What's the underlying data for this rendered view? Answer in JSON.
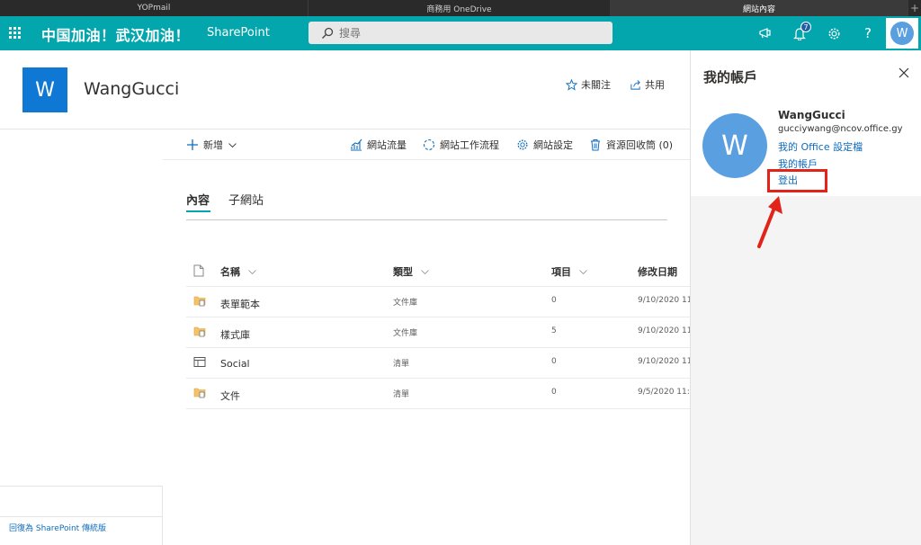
{
  "browser": {
    "tabs": [
      {
        "label": "YOPmail"
      },
      {
        "label": "商務用 OneDrive"
      },
      {
        "label": "網站內容"
      }
    ],
    "new_tab": "+"
  },
  "header": {
    "brand": "中国加油！武汉加油！",
    "app_name": "SharePoint",
    "search_placeholder": "搜尋",
    "notification_count": "7",
    "avatar_initial": "W",
    "accent_color": "#03a6ac"
  },
  "site": {
    "logo_letter": "W",
    "title": "WangGucci",
    "follow_label": "未關注",
    "share_label": "共用"
  },
  "commands": {
    "new_label": "新增",
    "analytics_label": "網站流量",
    "workflow_label": "網站工作流程",
    "settings_label": "網站設定",
    "recycle_label": "資源回收筒 (0)"
  },
  "pivots": {
    "contents": "內容",
    "subsites": "子網站"
  },
  "list": {
    "columns": {
      "name": "名稱",
      "type": "類型",
      "items": "項目",
      "modified": "修改日期"
    },
    "rows": [
      {
        "name": "表單範本",
        "type": "文件庫",
        "items": "0",
        "modified": "9/10/2020 11:"
      },
      {
        "name": "樣式庫",
        "type": "文件庫",
        "items": "5",
        "modified": "9/10/2020 11:"
      },
      {
        "name": "Social",
        "type": "清單",
        "items": "0",
        "modified": "9/10/2020 11:"
      },
      {
        "name": "文件",
        "type": "清單",
        "items": "0",
        "modified": "9/5/2020 11:2"
      }
    ]
  },
  "footer": {
    "classic_link": "回復為 SharePoint 傳統版"
  },
  "account_panel": {
    "title": "我的帳戶",
    "avatar_initial": "W",
    "name": "WangGucci",
    "email": "gucciywang@ncov.office.gy",
    "office_profile": "我的 Office 設定檔",
    "my_account": "我的帳戶",
    "sign_out": "登出"
  }
}
